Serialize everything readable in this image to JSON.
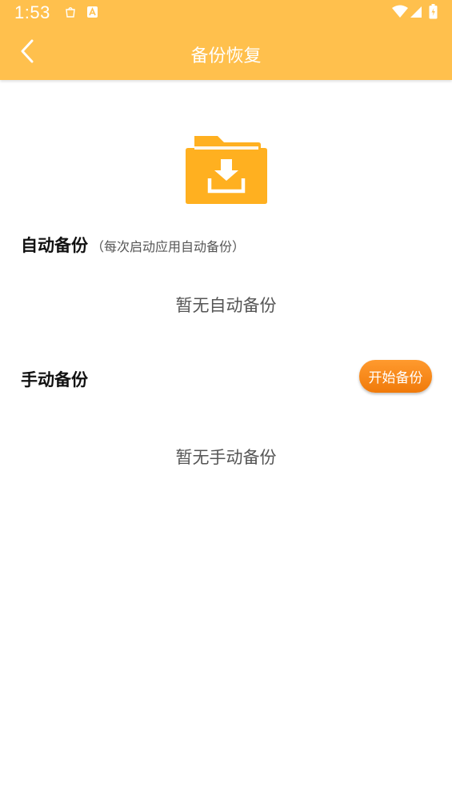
{
  "status_bar": {
    "time": "1:53",
    "icons": [
      "notification-bag-icon",
      "app-a-icon",
      "wifi-icon",
      "signal-icon",
      "battery-icon"
    ]
  },
  "app_bar": {
    "title": "备份恢复",
    "back_icon": "chevron-left-icon"
  },
  "colors": {
    "header_bg": "#FFC04D",
    "folder": "#FFB020",
    "button": "#F5880F"
  },
  "hero": {
    "icon": "folder-download-icon"
  },
  "auto_backup": {
    "title": "自动备份",
    "subtitle": "（每次启动应用自动备份）",
    "empty_text": "暂无自动备份"
  },
  "manual_backup": {
    "title": "手动备份",
    "button_label": "开始备份",
    "empty_text": "暂无手动备份"
  }
}
